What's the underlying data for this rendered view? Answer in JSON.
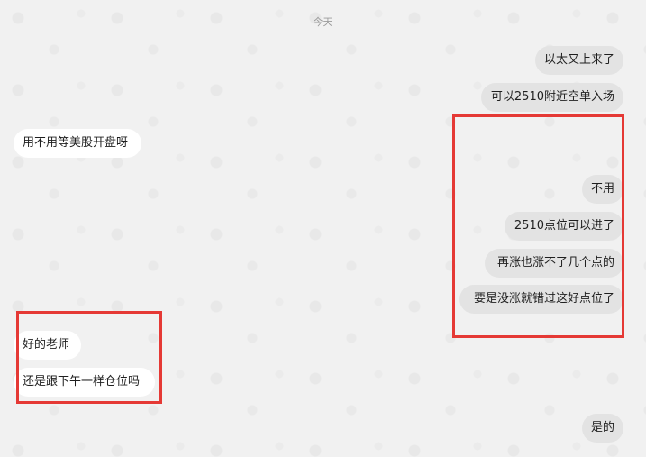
{
  "chat": {
    "date_separator": "今天",
    "messages": [
      {
        "side": "right",
        "text": "以太又上来了"
      },
      {
        "side": "right",
        "text": "可以2510附近空单入场"
      },
      {
        "side": "left",
        "text": "用不用等美股开盘呀"
      },
      {
        "side": "right",
        "text": "不用"
      },
      {
        "side": "right",
        "text": "2510点位可以进了"
      },
      {
        "side": "right",
        "text": "再涨也涨不了几个点的"
      },
      {
        "side": "right",
        "text": "要是没涨就错过这好点位了"
      },
      {
        "side": "left",
        "text": "好的老师"
      },
      {
        "side": "left",
        "text": "还是跟下午一样仓位吗"
      },
      {
        "side": "right",
        "text": "是的"
      }
    ]
  },
  "annotations": {
    "highlight_color": "#e53935"
  }
}
